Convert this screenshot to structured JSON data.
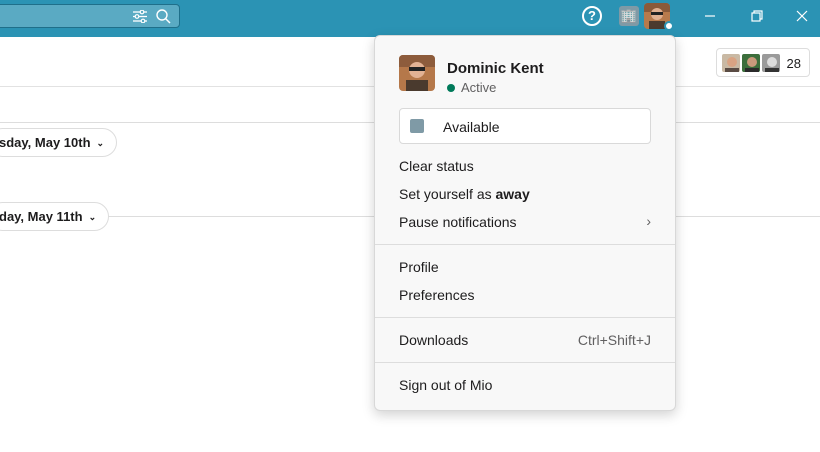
{
  "topbar": {
    "search_icons": [
      "filter-icon",
      "search-icon"
    ],
    "help_label": "?",
    "status_emoji": "🏢",
    "window_controls": [
      "minimize-icon",
      "maximize-icon",
      "close-icon"
    ],
    "bar_color": "#2b93b4"
  },
  "channel": {
    "member_count": "28",
    "dates": [
      "sday, May 10th",
      "day, May 11th"
    ]
  },
  "menu": {
    "user_name": "Dominic Kent",
    "presence": "Active",
    "presence_color": "#007a5a",
    "status_emoji": "🏢",
    "status_text": "Available",
    "clear_status": "Clear status",
    "set_away_prefix": "Set yourself as ",
    "set_away_bold": "away",
    "pause_notifications": "Pause notifications",
    "pause_chevron": "›",
    "profile": "Profile",
    "preferences": "Preferences",
    "downloads": "Downloads",
    "downloads_shortcut": "Ctrl+Shift+J",
    "sign_out": "Sign out of Mio"
  }
}
